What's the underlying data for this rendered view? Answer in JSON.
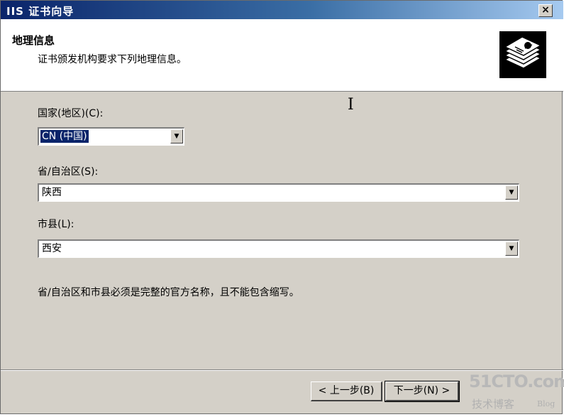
{
  "window": {
    "title": "IIS 证书向导",
    "close_label": "×"
  },
  "header": {
    "title": "地理信息",
    "subtitle": "证书颁发机构要求下列地理信息。",
    "icon": "certificate-wizard-icon"
  },
  "fields": {
    "country": {
      "label": "国家(地区)(C):",
      "value": "CN (中国)"
    },
    "province": {
      "label": "省/自治区(S):",
      "value": "陕西"
    },
    "city": {
      "label": "市县(L):",
      "value": "西安"
    }
  },
  "note": "省/自治区和市县必须是完整的官方名称，且不能包含缩写。",
  "buttons": {
    "back": "< 上一步(B)",
    "next": "下一步(N) >"
  },
  "watermark": {
    "main": "51CTO.com",
    "sub": "技术博客",
    "blog": "Blog"
  },
  "colors": {
    "titlebar_start": "#0a246a",
    "dialog_bg": "#d4d0c8",
    "selection": "#0a246a"
  }
}
